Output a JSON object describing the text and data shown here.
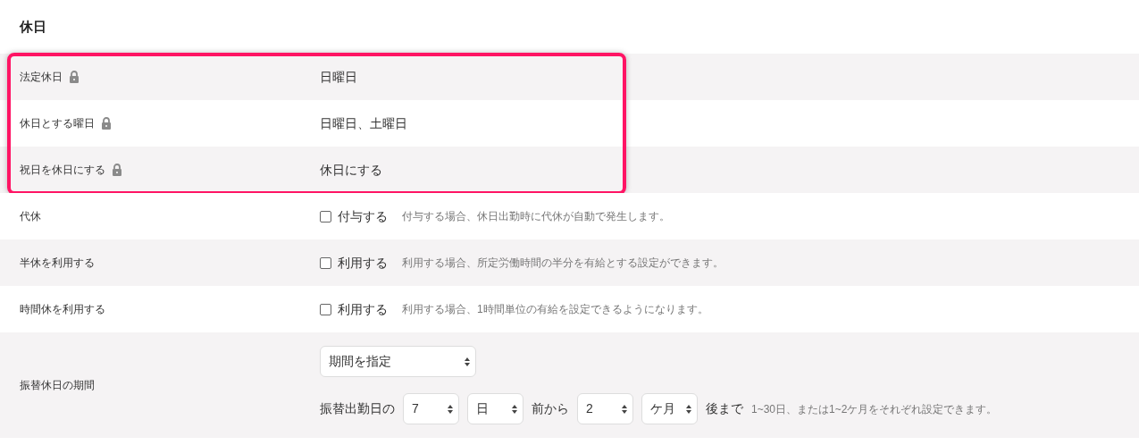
{
  "heading": "休日",
  "sections": [
    {
      "highlighted": true,
      "rows": [
        {
          "kind": "text",
          "label": "法定休日",
          "locked": true,
          "value": "日曜日"
        },
        {
          "kind": "text",
          "label": "休日とする曜日",
          "locked": true,
          "value": "日曜日、土曜日"
        },
        {
          "kind": "text",
          "label": "祝日を休日にする",
          "locked": true,
          "value": "休日にする"
        }
      ]
    },
    {
      "highlighted": false,
      "rows": [
        {
          "kind": "checkbox",
          "label": "代休",
          "locked": false,
          "checked": false,
          "option": "付与する",
          "hint": "付与する場合、休日出勤時に代休が自動で発生します。"
        },
        {
          "kind": "checkbox",
          "label": "半休を利用する",
          "locked": false,
          "checked": false,
          "option": "利用する",
          "hint": "利用する場合、所定労働時間の半分を有給とする設定ができます。"
        },
        {
          "kind": "checkbox",
          "label": "時間休を利用する",
          "locked": false,
          "checked": false,
          "option": "利用する",
          "hint": "利用する場合、1時間単位の有給を設定できるようになります。"
        },
        {
          "kind": "period",
          "label": "振替休日の期間",
          "locked": false,
          "mode": "期間を指定",
          "parts": [
            {
              "kind": "text",
              "text": "振替出勤日の"
            },
            {
              "kind": "select",
              "value": "7"
            },
            {
              "kind": "select",
              "value": "日"
            },
            {
              "kind": "text",
              "text": "前から"
            },
            {
              "kind": "select",
              "value": "2"
            },
            {
              "kind": "select",
              "value": "ケ月"
            },
            {
              "kind": "text",
              "text": "後まで"
            },
            {
              "kind": "hint",
              "text": "1~30日、または1~2ケ月をそれぞれ設定できます。"
            }
          ]
        }
      ]
    }
  ]
}
